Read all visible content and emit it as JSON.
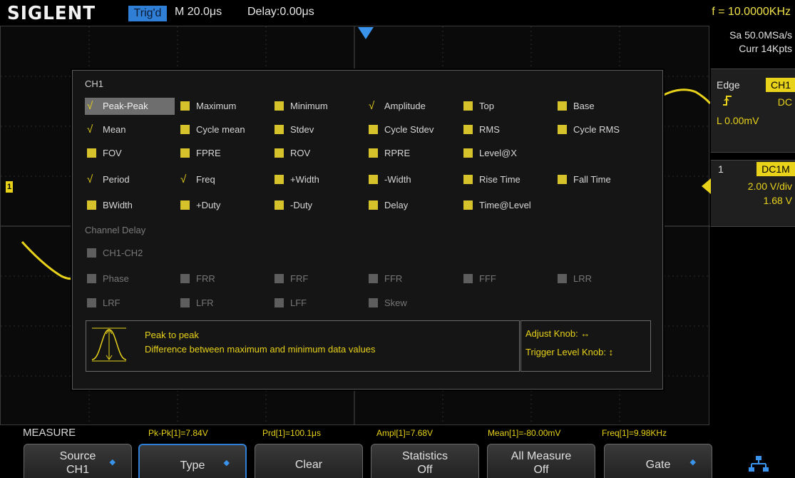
{
  "header": {
    "logo": "SIGLENT",
    "trigger_status": "Trig'd",
    "timebase": "M 20.0μs",
    "delay": "Delay:0.00μs",
    "frequency": "f = 10.0000KHz"
  },
  "acquisition": {
    "sample_rate": "Sa 50.0MSa/s",
    "memory_depth": "Curr 14Kpts"
  },
  "trigger": {
    "type": "Edge",
    "source": "CH1",
    "slope_icon": "rising-edge-icon",
    "coupling": "DC",
    "level": "L  0.00mV"
  },
  "channel": {
    "number": "1",
    "coupling": "DC1M",
    "scale": "2.00 V/div",
    "offset": "1.68 V"
  },
  "measure_dialog": {
    "title": "CH1",
    "rows": [
      [
        {
          "label": "Peak-Peak",
          "state": "checked",
          "selected": true
        },
        {
          "label": "Maximum",
          "state": "box"
        },
        {
          "label": "Minimum",
          "state": "box"
        },
        {
          "label": "Amplitude",
          "state": "checked"
        },
        {
          "label": "Top",
          "state": "box"
        },
        {
          "label": "Base",
          "state": "box"
        }
      ],
      [
        {
          "label": "Mean",
          "state": "checked"
        },
        {
          "label": "Cycle mean",
          "state": "box"
        },
        {
          "label": "Stdev",
          "state": "box"
        },
        {
          "label": "Cycle Stdev",
          "state": "box"
        },
        {
          "label": "RMS",
          "state": "box"
        },
        {
          "label": "Cycle RMS",
          "state": "box"
        }
      ],
      [
        {
          "label": "FOV",
          "state": "box"
        },
        {
          "label": "FPRE",
          "state": "box"
        },
        {
          "label": "ROV",
          "state": "box"
        },
        {
          "label": "RPRE",
          "state": "box"
        },
        {
          "label": "Level@X",
          "state": "box"
        }
      ],
      [
        {
          "label": "Period",
          "state": "checked"
        },
        {
          "label": "Freq",
          "state": "checked"
        },
        {
          "label": "+Width",
          "state": "box"
        },
        {
          "label": "-Width",
          "state": "box"
        },
        {
          "label": "Rise Time",
          "state": "box"
        },
        {
          "label": "Fall Time",
          "state": "box"
        }
      ],
      [
        {
          "label": "BWidth",
          "state": "box"
        },
        {
          "label": "+Duty",
          "state": "box"
        },
        {
          "label": "-Duty",
          "state": "box"
        },
        {
          "label": "Delay",
          "state": "box"
        },
        {
          "label": "Time@Level",
          "state": "box"
        }
      ]
    ],
    "channel_delay_header": "Channel Delay",
    "delay_rows": [
      [
        {
          "label": "CH1-CH2",
          "state": "box"
        }
      ],
      [
        {
          "label": "Phase",
          "state": "box"
        },
        {
          "label": "FRR",
          "state": "box"
        },
        {
          "label": "FRF",
          "state": "box"
        },
        {
          "label": "FFR",
          "state": "box"
        },
        {
          "label": "FFF",
          "state": "box"
        },
        {
          "label": "LRR",
          "state": "box"
        }
      ],
      [
        {
          "label": "LRF",
          "state": "box"
        },
        {
          "label": "LFR",
          "state": "box"
        },
        {
          "label": "LFF",
          "state": "box"
        },
        {
          "label": "Skew",
          "state": "box"
        }
      ]
    ],
    "description": {
      "icon": "peak-to-peak-waveform-icon",
      "title": "Peak to peak",
      "text": "Difference between maximum and minimum data values"
    },
    "knob_help": {
      "adjust": "Adjust Knob: ↔",
      "trigger_level": "Trigger Level Knob: ↕"
    }
  },
  "measure_strip": {
    "label": "MEASURE",
    "values": [
      "Pk-Pk[1]=7.84V",
      "Prd[1]=100.1μs",
      "Ampl[1]=7.68V",
      "Mean[1]=-80.00mV",
      "Freq[1]=9.98KHz"
    ]
  },
  "softkeys": [
    {
      "line1": "Source",
      "line2": "CH1",
      "arrow": true,
      "active": false
    },
    {
      "line1": "Type",
      "line2": "",
      "arrow": true,
      "active": true
    },
    {
      "line1": "Clear",
      "line2": "",
      "arrow": false,
      "active": false
    },
    {
      "line1": "Statistics",
      "line2": "Off",
      "arrow": false,
      "active": false
    },
    {
      "line1": "All Measure",
      "line2": "Off",
      "arrow": false,
      "active": false
    },
    {
      "line1": "Gate",
      "line2": "",
      "arrow": true,
      "active": false
    }
  ],
  "colors": {
    "channel1": "#e8d21a",
    "accent_blue": "#2f7fd6",
    "background": "#000000"
  }
}
